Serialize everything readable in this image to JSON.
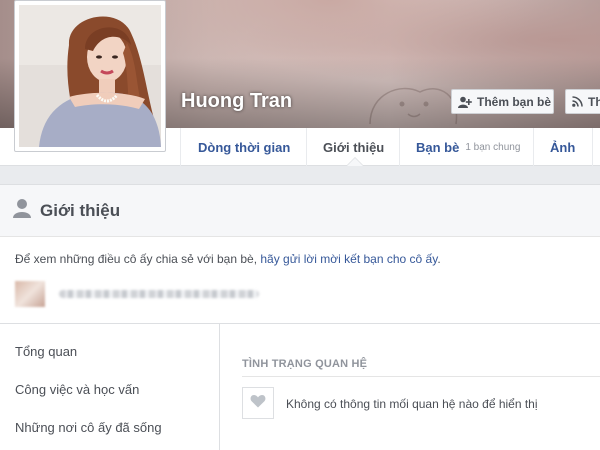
{
  "profile": {
    "name": "Huong Tran"
  },
  "actions": {
    "add_friend_label": "Thêm bạn bè",
    "follow_label": "Th"
  },
  "tabs": [
    {
      "label": "Dòng thời gian",
      "active": false
    },
    {
      "label": "Giới thiệu",
      "active": true
    },
    {
      "label": "Bạn bè",
      "sub": "1 bạn chung",
      "active": false
    },
    {
      "label": "Ảnh",
      "active": false
    }
  ],
  "about": {
    "header_title": "Giới thiệu",
    "notice_text": "Để xem những điều cô ấy chia sẻ với bạn bè, ",
    "notice_link": "hãy gửi lời mời kết bạn cho cô ấy",
    "notice_end": "."
  },
  "sidebar": {
    "items": [
      {
        "label": "Tổng quan"
      },
      {
        "label": "Công việc và học vấn"
      },
      {
        "label": "Những nơi cô ấy đã sống"
      }
    ]
  },
  "relationship": {
    "section_title": "TÌNH TRẠNG QUAN HỆ",
    "empty_text": "Không có thông tin mối quan hệ nào để hiển thị"
  },
  "colors": {
    "link": "#365899",
    "tab_active": "#4b4f56",
    "background": "#e9ebee"
  }
}
